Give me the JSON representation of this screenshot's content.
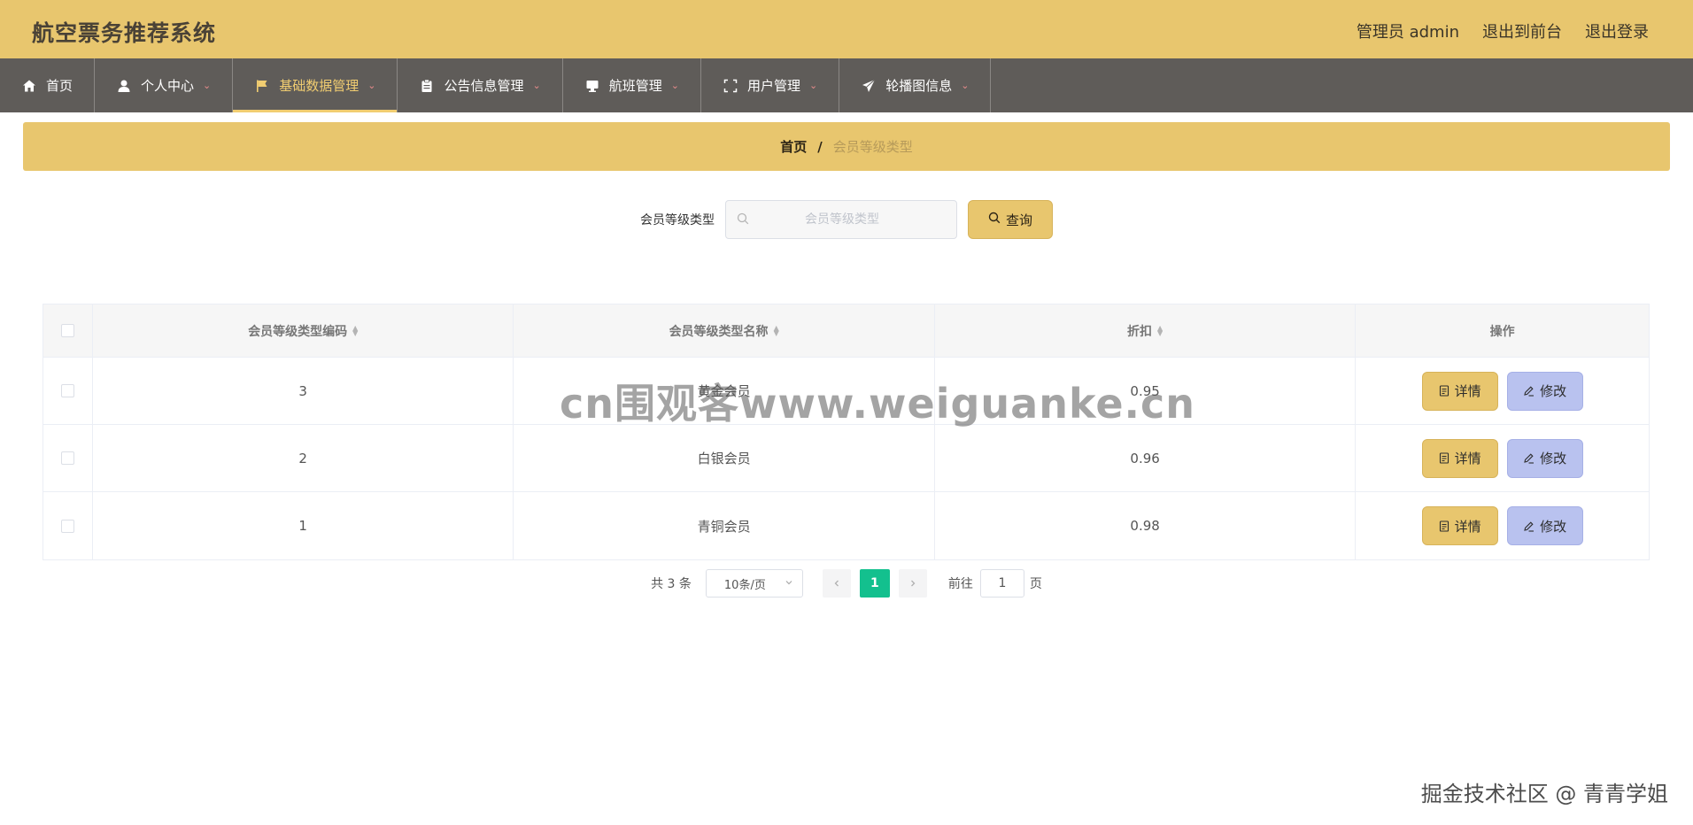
{
  "header": {
    "title": "航空票务推荐系统",
    "admin": "管理员 admin",
    "to_front": "退出到前台",
    "logout": "退出登录"
  },
  "nav": {
    "items": [
      {
        "label": "首页",
        "icon": "home-icon",
        "dropdown": false,
        "active": false
      },
      {
        "label": "个人中心",
        "icon": "user-icon",
        "dropdown": true,
        "active": false
      },
      {
        "label": "基础数据管理",
        "icon": "flag-icon",
        "dropdown": true,
        "active": true
      },
      {
        "label": "公告信息管理",
        "icon": "clipboard-icon",
        "dropdown": true,
        "active": false
      },
      {
        "label": "航班管理",
        "icon": "monitor-icon",
        "dropdown": true,
        "active": false
      },
      {
        "label": "用户管理",
        "icon": "fullscreen-icon",
        "dropdown": true,
        "active": false
      },
      {
        "label": "轮播图信息",
        "icon": "send-icon",
        "dropdown": true,
        "active": false
      }
    ],
    "caret": "⌄"
  },
  "breadcrumb": {
    "home": "首页",
    "separator": "/",
    "current": "会员等级类型"
  },
  "search": {
    "label": "会员等级类型",
    "placeholder": "会员等级类型",
    "value": "",
    "button_label": "查询"
  },
  "table": {
    "headers": {
      "code": "会员等级类型编码",
      "name": "会员等级类型名称",
      "discount": "折扣",
      "ops": "操作"
    },
    "rows": [
      {
        "code": "3",
        "name": "黄金会员",
        "discount": "0.95"
      },
      {
        "code": "2",
        "name": "白银会员",
        "discount": "0.96"
      },
      {
        "code": "1",
        "name": "青铜会员",
        "discount": "0.98"
      }
    ],
    "detail_label": "详情",
    "edit_label": "修改"
  },
  "pagination": {
    "total": "共 3 条",
    "page_size": "10条/页",
    "current_page": "1",
    "goto_label": "前往",
    "goto_value": "1",
    "goto_suffix": "页"
  },
  "watermarks": {
    "center": "cn围观客www.weiguanke.cn",
    "corner": "掘金技术社区 @ 青青学姐"
  },
  "colors": {
    "accent_yellow": "#e8c66e",
    "nav_bg": "#5f5c59",
    "nav_active": "#f1cd71",
    "edit_button": "#b9c2ef",
    "page_active": "#13c08e"
  }
}
